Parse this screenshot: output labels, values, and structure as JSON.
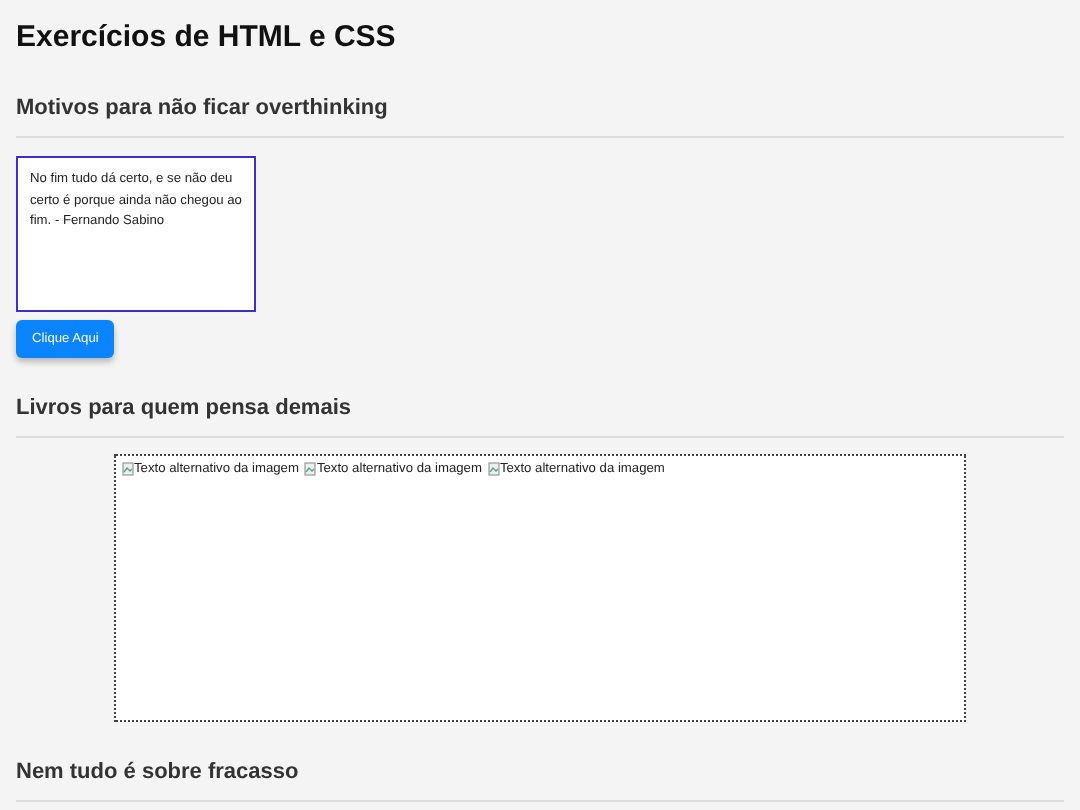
{
  "title": "Exercícios de HTML e CSS",
  "sections": [
    {
      "heading": "Motivos para não ficar overthinking",
      "kind": "quote",
      "quote": "No fim tudo dá certo, e se não deu certo é porque ainda não chegou ao fim. - Fernando Sabino",
      "button": "Clique Aqui"
    },
    {
      "heading": "Livros para quem pensa demais",
      "kind": "gallery",
      "images": [
        "Texto alternativo da imagem",
        "Texto alternativo da imagem",
        "Texto alternativo da imagem"
      ]
    },
    {
      "heading": "Nem tudo é sobre fracasso",
      "kind": "heading"
    }
  ]
}
